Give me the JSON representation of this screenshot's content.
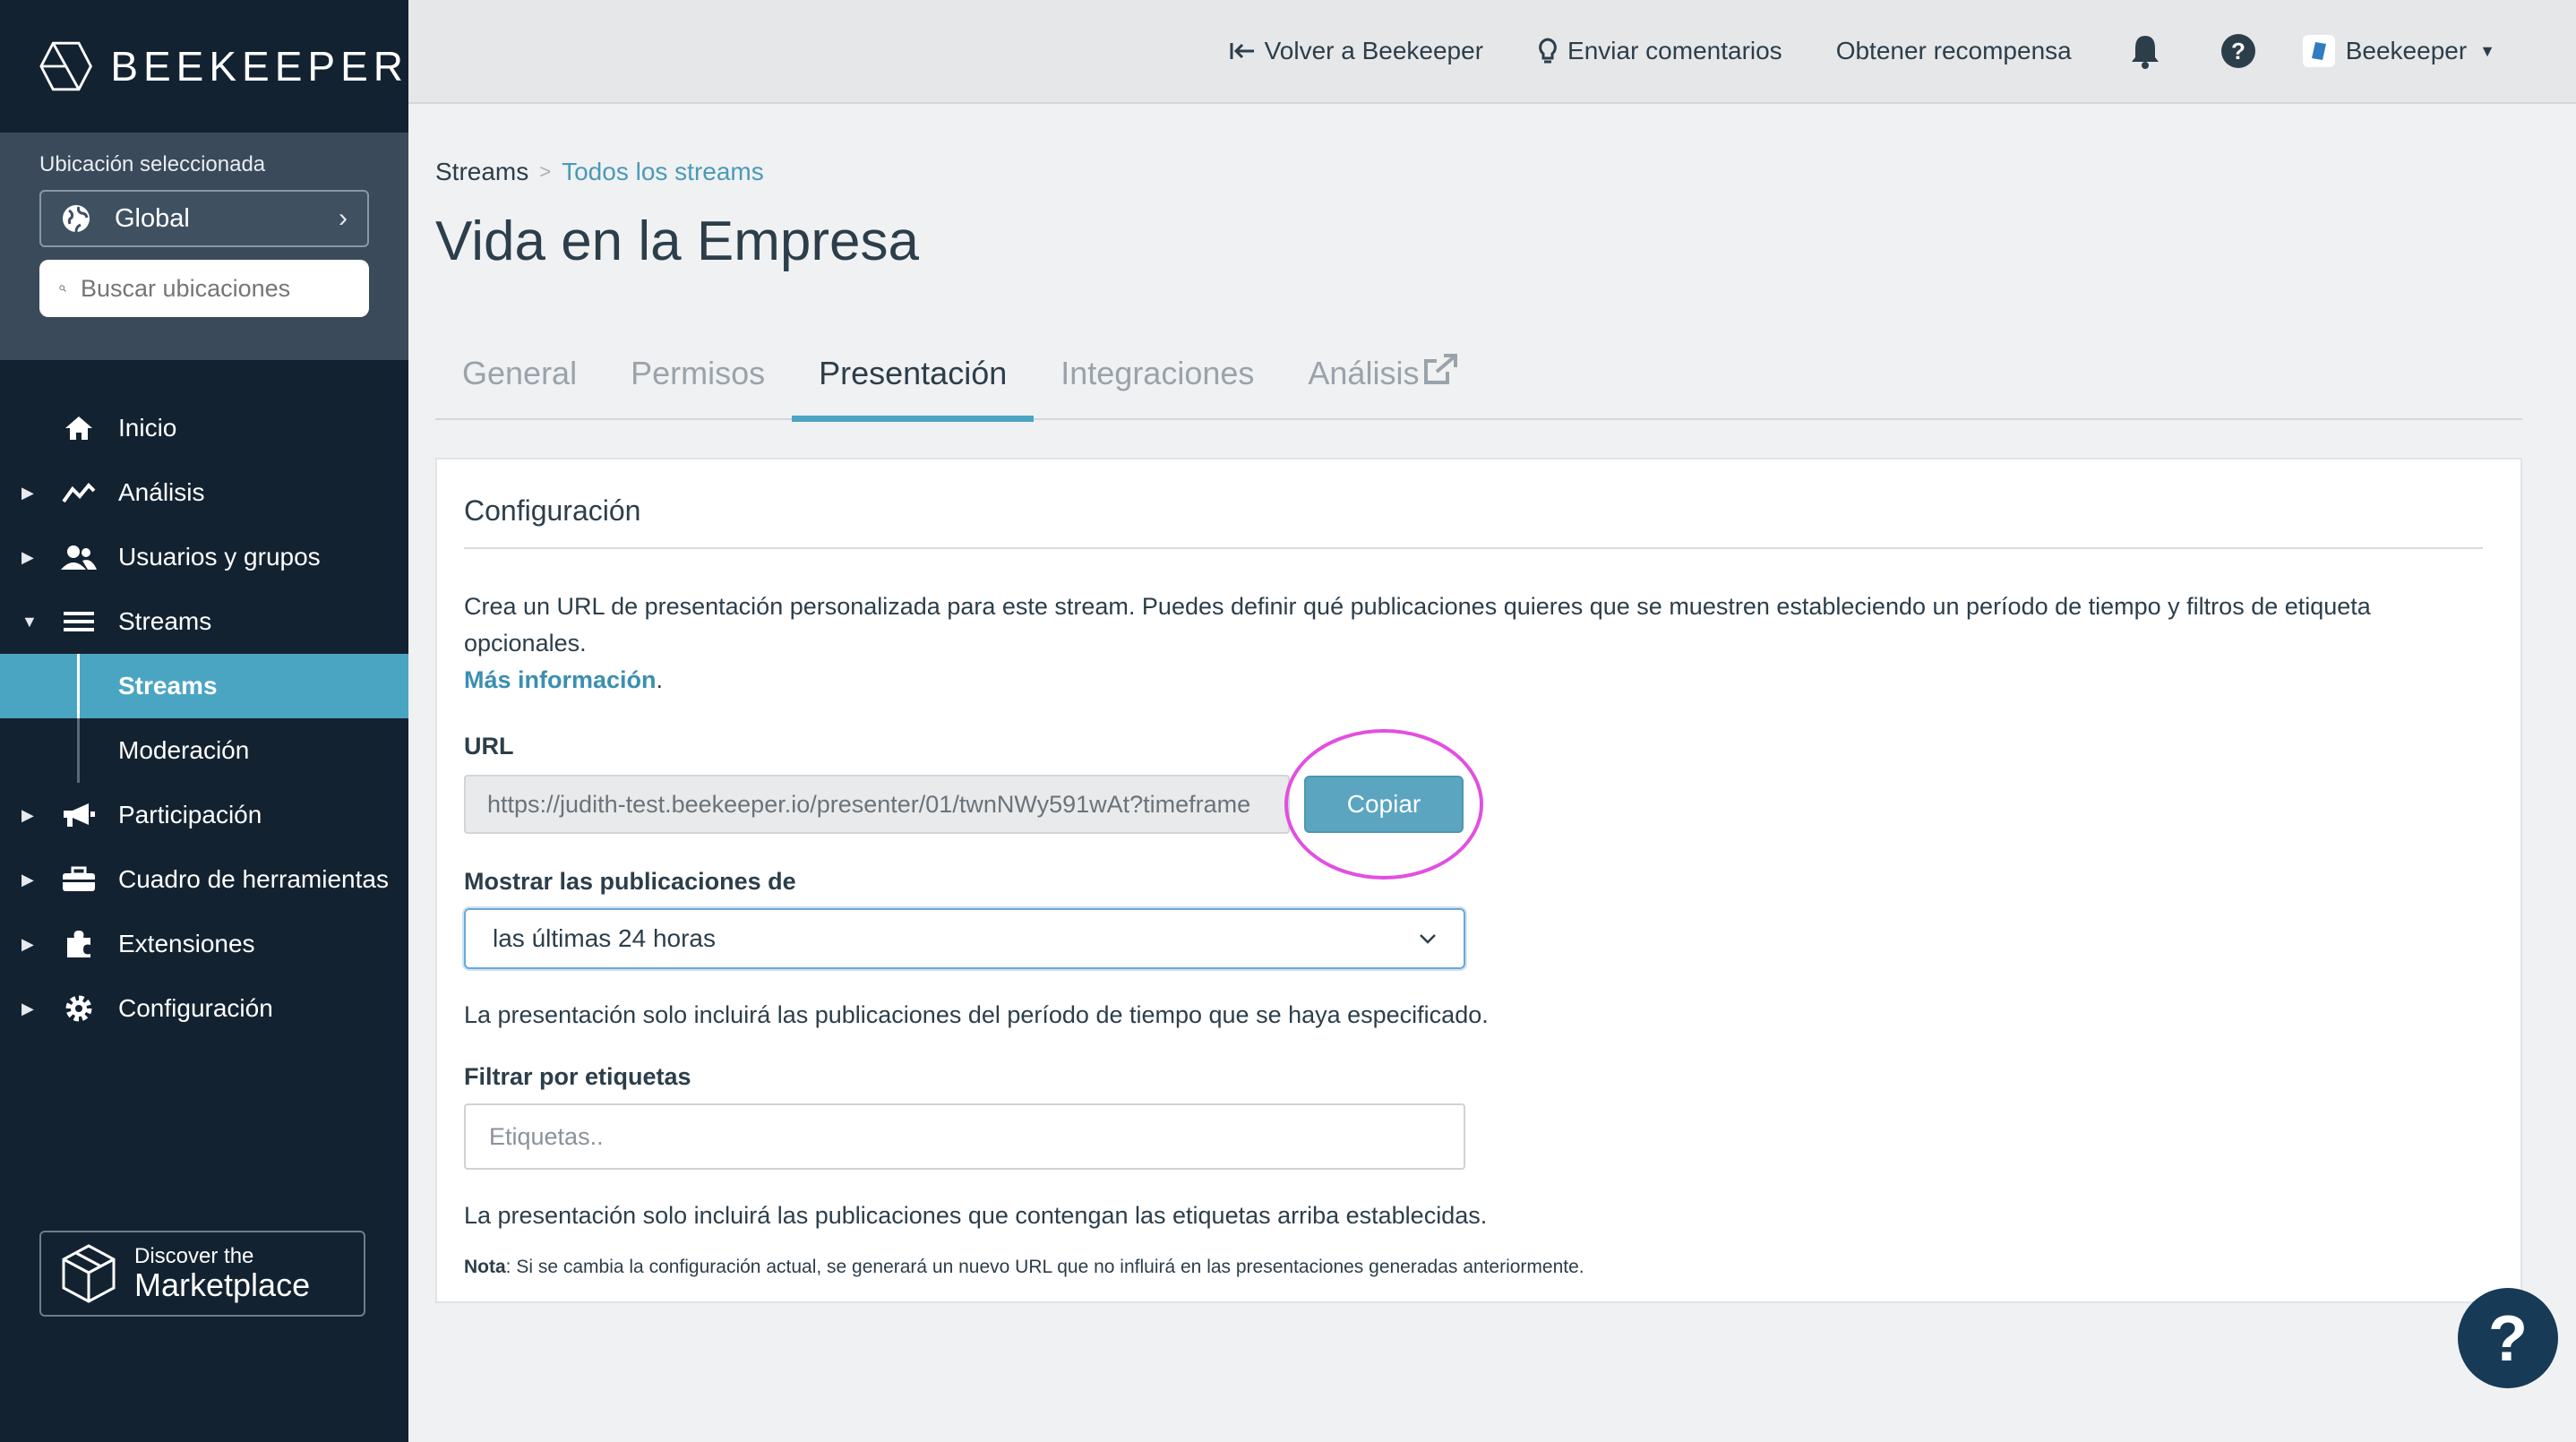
{
  "brand": {
    "name": "BEEKEEPER"
  },
  "location": {
    "label": "Ubicación seleccionada",
    "value": "Global",
    "search_placeholder": "Buscar ubicaciones"
  },
  "nav": {
    "inicio": "Inicio",
    "analisis": "Análisis",
    "usuarios": "Usuarios y grupos",
    "streams": "Streams",
    "streams_sub": "Streams",
    "moderacion": "Moderación",
    "participacion": "Participación",
    "herramientas": "Cuadro de herramientas",
    "extensiones": "Extensiones",
    "configuracion": "Configuración"
  },
  "marketplace": {
    "line1": "Discover the",
    "line2": "Marketplace"
  },
  "topbar": {
    "back": "Volver a Beekeeper",
    "feedback": "Enviar comentarios",
    "reward": "Obtener recompensa",
    "user": "Beekeeper"
  },
  "breadcrumb": {
    "root": "Streams",
    "sep": ">",
    "current": "Todos los streams"
  },
  "page": {
    "title": "Vida en la Empresa"
  },
  "tabs": {
    "general": "General",
    "permisos": "Permisos",
    "presentacion": "Presentación",
    "integraciones": "Integraciones",
    "analisis": "Análisis"
  },
  "config": {
    "title": "Configuración",
    "description": "Crea un URL de presentación personalizada para este stream. Puedes definir qué publicaciones quieres que se muestren estableciendo un período de tiempo y filtros de etiqueta opcionales.",
    "more_info": "Más información",
    "url_label": "URL",
    "url_value": "https://judith-test.beekeeper.io/presenter/01/twnNWy591wAt?timeframe",
    "copy_button": "Copiar",
    "show_label": "Mostrar las publicaciones de",
    "show_value": "las últimas 24 horas",
    "show_help": "La presentación solo incluirá las publicaciones del período de tiempo que se haya especificado.",
    "tags_label": "Filtrar por etiquetas",
    "tags_placeholder": "Etiquetas..",
    "tags_help": "La presentación solo incluirá las publicaciones que contengan las etiquetas arriba establecidas.",
    "note_label": "Nota",
    "note_text": ": Si se cambia la configuración actual, se generará un nuevo URL que no influirá en las presentaciones generadas anteriormente."
  },
  "colors": {
    "sidebar": "#132231",
    "accent": "#4aa5c3",
    "highlight": "#e24fe0",
    "fab": "#173a57"
  }
}
